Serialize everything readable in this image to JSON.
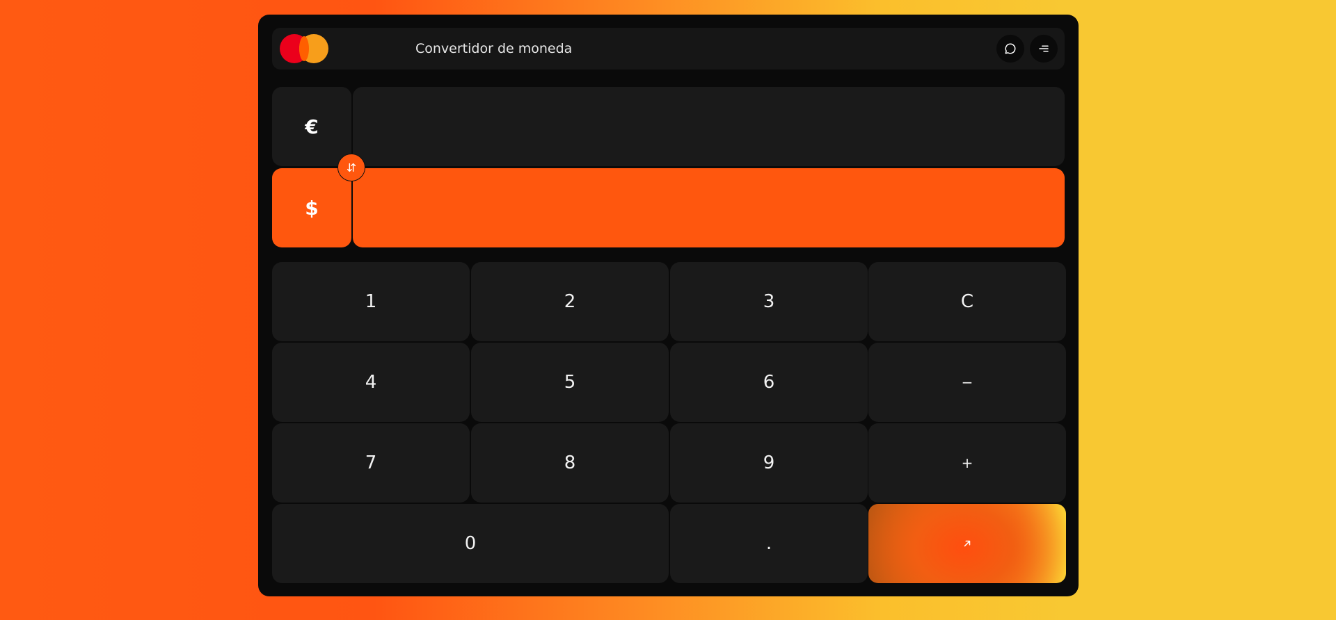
{
  "window": {
    "title": "Convertidor de moneda"
  },
  "header": {
    "logo_icon": "mastercard-logo",
    "chat_icon": "chat-bubble-icon",
    "menu_icon": "menu-lines-icon"
  },
  "converter": {
    "from": {
      "symbol": "€",
      "amount": ""
    },
    "to": {
      "symbol": "$",
      "amount": ""
    },
    "swap_icon": "swap-arrows-icon"
  },
  "keypad": {
    "k1": "1",
    "k2": "2",
    "k3": "3",
    "clear": "C",
    "k4": "4",
    "k5": "5",
    "k6": "6",
    "minus": "−",
    "k7": "7",
    "k8": "8",
    "k9": "9",
    "plus": "+",
    "k0": "0",
    "dot": ".",
    "submit_icon": "arrow-up-right-icon"
  },
  "colors": {
    "accent": "#ff570e",
    "panel": "#1a1a1a",
    "background": "#0a0a0a"
  }
}
